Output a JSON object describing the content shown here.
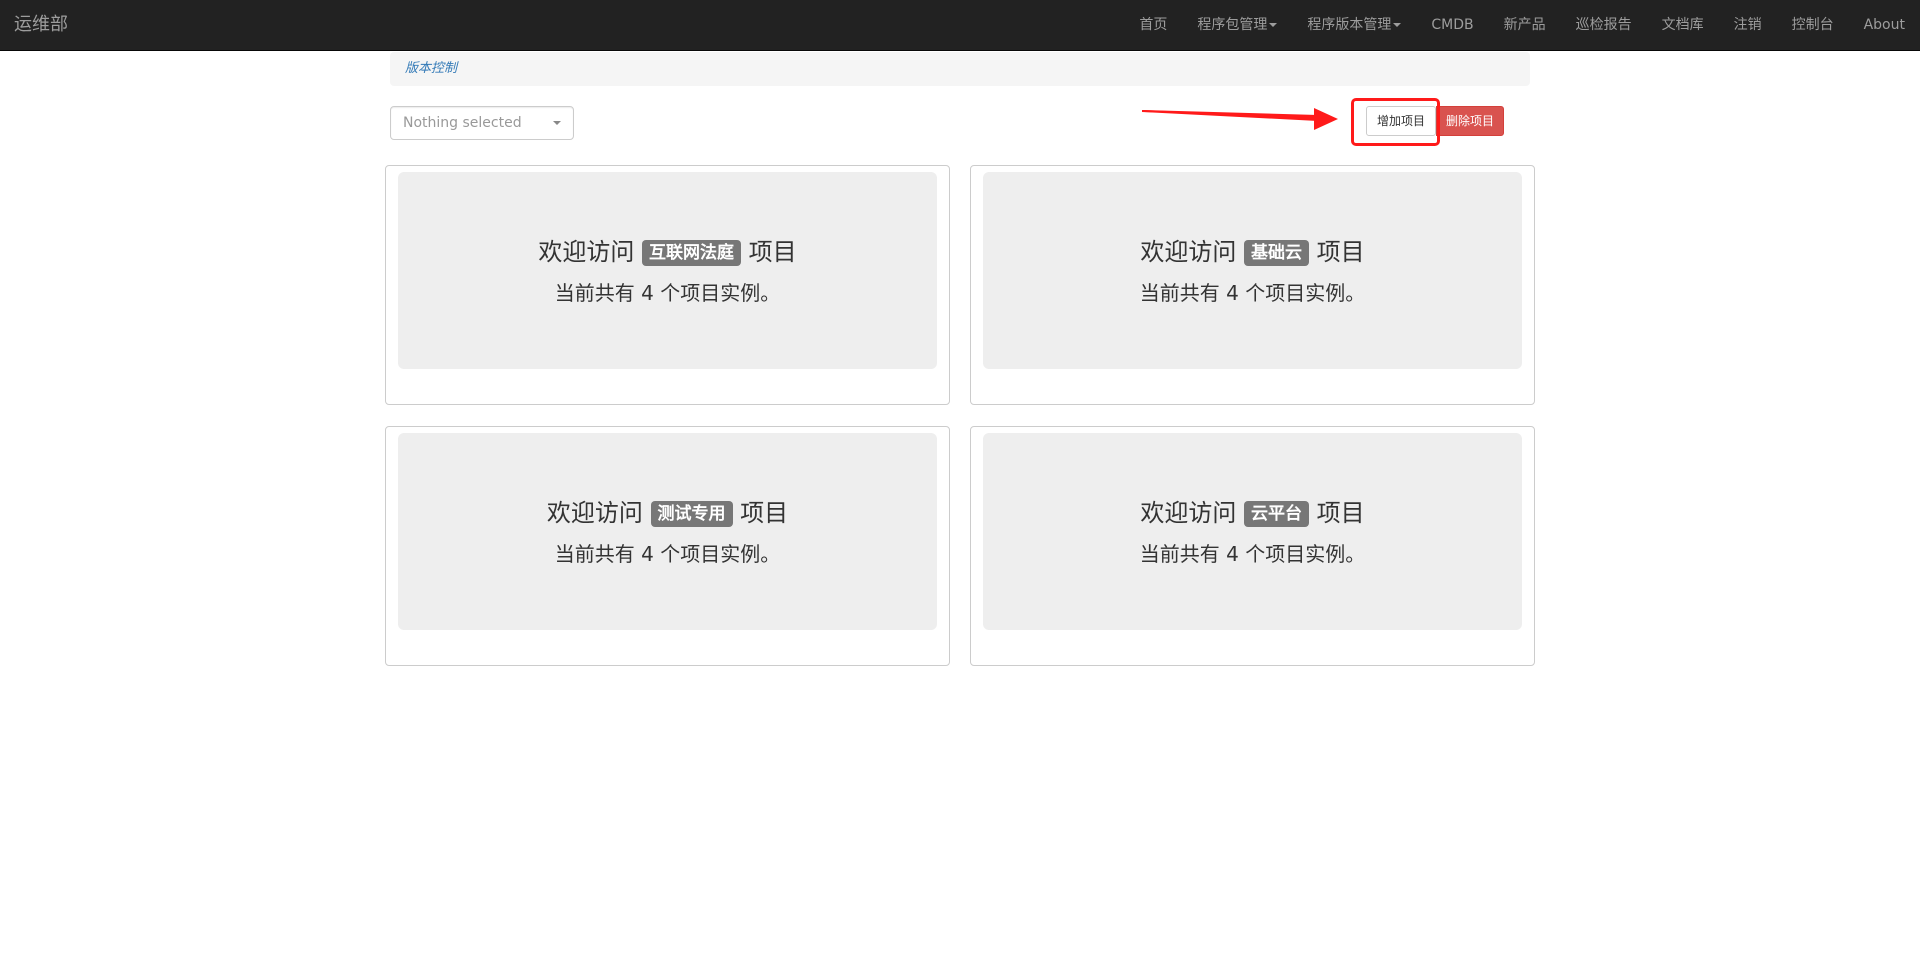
{
  "navbar": {
    "brand": "运维部",
    "items": [
      {
        "label": "首页"
      },
      {
        "label": "程序包管理"
      },
      {
        "label": "程序版本管理"
      },
      {
        "label": "CMDB"
      },
      {
        "label": "新产品"
      },
      {
        "label": "巡检报告"
      },
      {
        "label": "文档库"
      },
      {
        "label": "注销"
      },
      {
        "label": "控制台"
      },
      {
        "label": "About"
      }
    ]
  },
  "breadcrumb": {
    "label": "版本控制"
  },
  "filter": {
    "placeholder": "Nothing selected"
  },
  "actions": {
    "add_label": "增加项目",
    "delete_label": "删除项目"
  },
  "annotation": {
    "color": "#ff1a1a"
  },
  "projects": [
    {
      "prefix": "欢迎访问",
      "name": "互联网法庭",
      "suffix": "项目",
      "count_text": "当前共有 4 个项目实例。"
    },
    {
      "prefix": "欢迎访问",
      "name": "基础云",
      "suffix": "项目",
      "count_text": "当前共有 4 个项目实例。"
    },
    {
      "prefix": "欢迎访问",
      "name": "测试专用",
      "suffix": "项目",
      "count_text": "当前共有 4 个项目实例。"
    },
    {
      "prefix": "欢迎访问",
      "name": "云平台",
      "suffix": "项目",
      "count_text": "当前共有 4 个项目实例。"
    }
  ]
}
